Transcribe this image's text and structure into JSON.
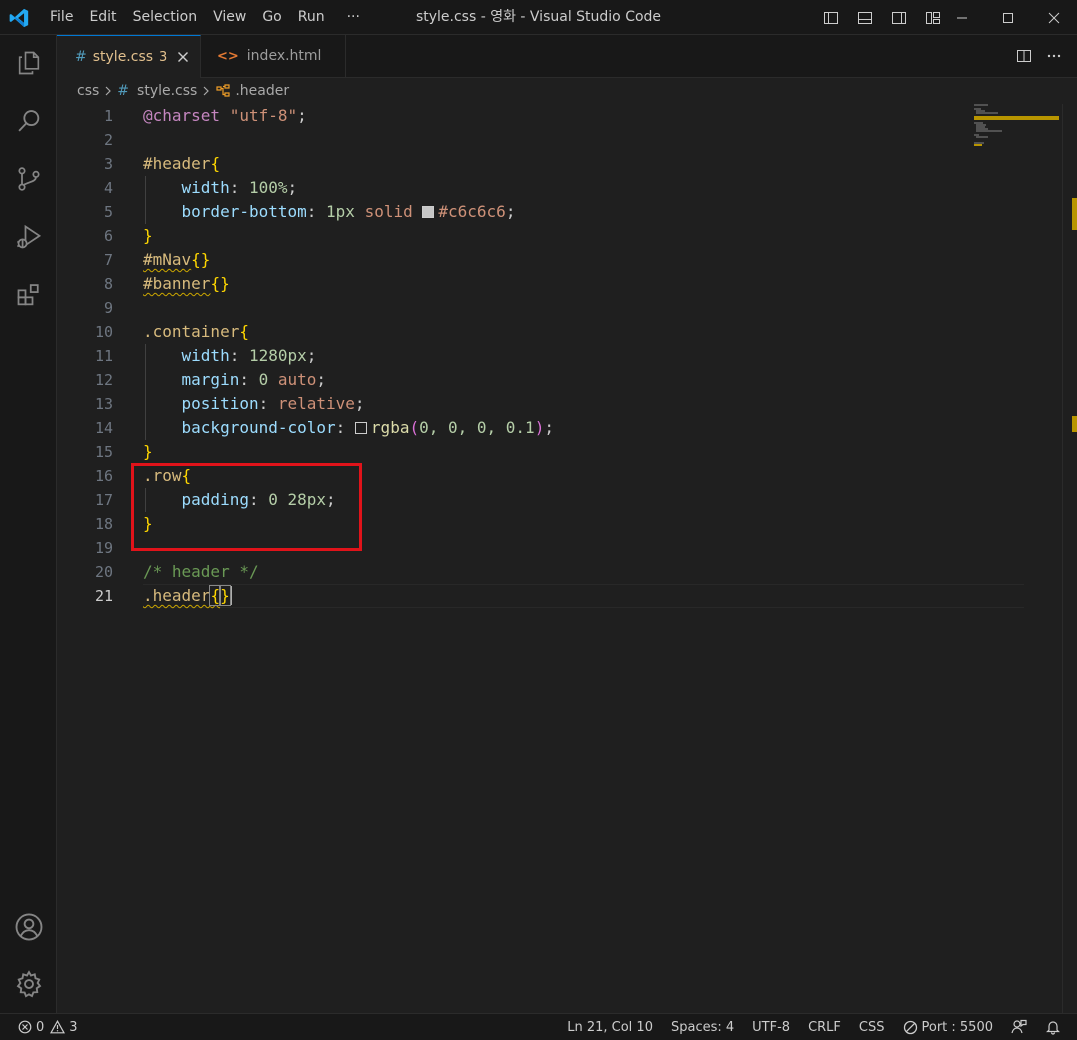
{
  "window": {
    "title": "style.css - 영화 - Visual Studio Code",
    "menu": [
      "File",
      "Edit",
      "Selection",
      "View",
      "Go",
      "Run",
      "···"
    ]
  },
  "activity_bar": {
    "top": [
      "explorer-icon",
      "search-icon",
      "source-control-icon",
      "run-debug-icon",
      "extensions-icon"
    ],
    "bottom": [
      "account-icon",
      "settings-gear-icon"
    ]
  },
  "tabs": [
    {
      "icon": "#",
      "label": "style.css",
      "badge": "3",
      "active": true
    },
    {
      "icon": "<>",
      "label": "index.html",
      "active": false
    }
  ],
  "breadcrumb": {
    "folder": "css",
    "file_icon": "#",
    "file": "style.css",
    "symbol": ".header"
  },
  "editor": {
    "active_line": 21,
    "line_numbers": [
      "1",
      "2",
      "3",
      "4",
      "5",
      "6",
      "7",
      "8",
      "9",
      "10",
      "11",
      "12",
      "13",
      "14",
      "15",
      "16",
      "17",
      "18",
      "19",
      "20",
      "21"
    ],
    "code": {
      "l1_at": "@charset",
      "l1_str": "\"utf-8\"",
      "l1_semi": ";",
      "l3_sel": "#header",
      "l3_brace": "{",
      "l4_prop": "width",
      "l4_colon": ": ",
      "l4_num": "100%",
      "l4_semi": ";",
      "l5_prop": "border-bottom",
      "l5_colon": ": ",
      "l5_num": "1px",
      "l5_val": " solid ",
      "l5_hex": "#c6c6c6",
      "l5_semi": ";",
      "l6_brace": "}",
      "l7_sel": "#mNav",
      "l7_brace": "{}",
      "l8_sel": "#banner",
      "l8_brace": "{}",
      "l10_sel": ".container",
      "l10_brace": "{",
      "l11_prop": "width",
      "l11_colon": ": ",
      "l11_num": "1280px",
      "l11_semi": ";",
      "l12_prop": "margin",
      "l12_colon": ": ",
      "l12_num": "0",
      "l12_val": " auto",
      "l12_semi": ";",
      "l13_prop": "position",
      "l13_colon": ": ",
      "l13_val": "relative",
      "l13_semi": ";",
      "l14_prop": "background-color",
      "l14_colon": ": ",
      "l14_fn": "rgba",
      "l14_open": "(",
      "l14_args": "0, 0, 0, 0.1",
      "l14_close": ")",
      "l14_semi": ";",
      "l15_brace": "}",
      "l16_sel": ".row",
      "l16_brace": "{",
      "l17_prop": "padding",
      "l17_colon": ": ",
      "l17_num": "0 28px",
      "l17_semi": ";",
      "l18_brace": "}",
      "l20_comment": "/* header */",
      "l21_sel": ".header",
      "l21_open": "{",
      "l21_close": "}"
    },
    "swatch_colors": {
      "border": "#c6c6c6",
      "background": "rgba(0,0,0,0.1)"
    }
  },
  "status_bar": {
    "errors": "0",
    "warnings": "3",
    "position": "Ln 21, Col 10",
    "spaces": "Spaces: 4",
    "encoding": "UTF-8",
    "eol": "CRLF",
    "language": "CSS",
    "port": "Port : 5500"
  },
  "colors": {
    "accent": "#0078d4",
    "highlight_box": "#e0131a",
    "warning": "#cca700"
  }
}
